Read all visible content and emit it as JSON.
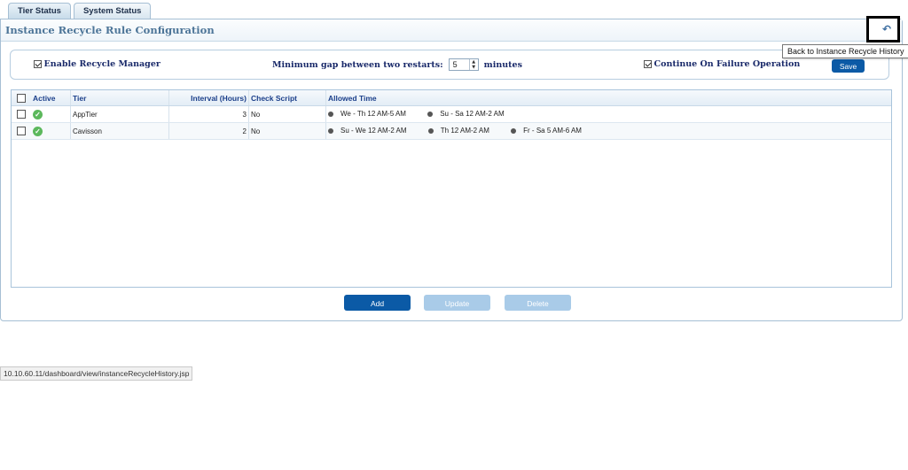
{
  "tabs": [
    {
      "label": "Tier Status"
    },
    {
      "label": "System Status"
    }
  ],
  "panel": {
    "title": "Instance Recycle Rule Configuration",
    "back_icon": "undo-arrow-icon",
    "tooltip": "Back to Instance Recycle History"
  },
  "settings": {
    "enable_label": "Enable Recycle Manager",
    "enable_checked": true,
    "gap_label": "Minimum gap between two restarts:",
    "gap_value": "5",
    "gap_unit": "minutes",
    "continue_label": "Continue On Failure Operation",
    "continue_checked": true,
    "save_label": "Save"
  },
  "table": {
    "headers": [
      "Active",
      "Tier",
      "Interval (Hours)",
      "Check Script",
      "Allowed Time"
    ],
    "rows": [
      {
        "tier": "AppTier",
        "interval": "3",
        "check_script": "No",
        "allowed": [
          "We - Th 12 AM-5 AM",
          "Su - Sa 12 AM-2 AM"
        ]
      },
      {
        "tier": "Cavisson",
        "interval": "2",
        "check_script": "No",
        "allowed": [
          "Su - We 12 AM-2 AM",
          "Th 12 AM-2 AM",
          "Fr - Sa 5 AM-6 AM"
        ]
      }
    ]
  },
  "buttons": {
    "add": "Add",
    "update": "Update",
    "delete": "Delete"
  },
  "status_url": "10.10.60.11/dashboard/view/instanceRecycleHistory.jsp",
  "colors": {
    "primary": "#0b5aa6",
    "disabled": "#a9cbe8",
    "active": "#5cb85c",
    "title": "#4d7598"
  }
}
